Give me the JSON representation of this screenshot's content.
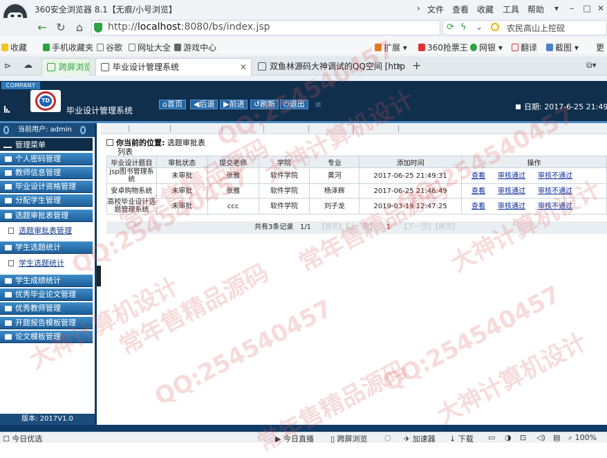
{
  "browser": {
    "window_title": "360安全浏览器 8.1【无痕/小号浏览】",
    "menu": [
      "文件",
      "查看",
      "收藏",
      "工具",
      "帮助"
    ],
    "url_scheme": "http://",
    "url_host": "localhost",
    "url_rest": ":8080/bs/index.jsp",
    "search_text": "农民高山上挖砚",
    "bookmarks": [
      "收藏",
      "手机收藏夹",
      "谷歌",
      "网址大全",
      "游戏中心",
      "扩展",
      "360抢票王",
      "网银",
      "翻译",
      "截图",
      "更"
    ],
    "tabs": [
      {
        "label": "跨屏浏览"
      },
      {
        "label": "毕业设计管理系统"
      },
      {
        "label": "双鱼林源码大神调试的QQ空间 [http"
      }
    ],
    "status": [
      "今日优选",
      "今日直播",
      "跨屏浏览",
      "加速器",
      "下载",
      "100%"
    ]
  },
  "app": {
    "company": "COMPANY",
    "logo_text": "TD",
    "title": "毕业设计管理系统",
    "nav": [
      "首页",
      "后退",
      "前进",
      "刷新",
      "退出"
    ],
    "date_label": "日期: 2017-6-25 21:49:",
    "current_user": "当前用户: admin",
    "menu_head": "管理菜单",
    "menu": [
      {
        "label": "个人密码管理"
      },
      {
        "label": "教师信息管理"
      },
      {
        "label": "毕业设计资格管理"
      },
      {
        "label": "分配学生管理"
      },
      {
        "label": "选题审批表管理"
      },
      {
        "label": "选题审批表管理",
        "sub": true
      },
      {
        "label": "学生选题统计"
      },
      {
        "label": "学生选题统计",
        "sub": true
      },
      {
        "label": "学生成绩统计"
      },
      {
        "label": "优秀毕业论文管理"
      },
      {
        "label": "优秀教师管理"
      },
      {
        "label": "开题报告模板管理"
      },
      {
        "label": "论文模板管理"
      }
    ],
    "version": "版本: 2017V1.0",
    "location_label": "你当前的位置:",
    "location_value": "选题审批表",
    "location_tail": "列表",
    "table": {
      "headers": [
        "毕业设计题目",
        "审批状态",
        "提交老师",
        "学院",
        "专业",
        "添加时间",
        "操作"
      ],
      "rows": [
        {
          "title": "jsp图书管理系统",
          "status": "未审批",
          "teacher": "张雅",
          "college": "软件学院",
          "major": "黄河",
          "time": "2017-06-25 21:49:31"
        },
        {
          "title": "安卓购物系统",
          "status": "未审批",
          "teacher": "张雅",
          "college": "软件学院",
          "major": "杨泽辉",
          "time": "2017-06-25 21:46:49"
        },
        {
          "title": "高校毕业设计选题管理系统",
          "status": "未审批",
          "teacher": "ccc",
          "college": "软件学院",
          "major": "刘子龙",
          "time": "2019-03-19 12:47:25"
        }
      ],
      "actions": [
        "查看",
        "审核通过",
        "审核不通过"
      ]
    },
    "pager": {
      "summary": "共有3条记录",
      "pages": "1/1",
      "first": "【首页】",
      "prev": "【上一页】",
      "current": "1",
      "next": "【下一页】",
      "last": "【尾页】"
    }
  },
  "watermark": [
    "QQ:254540457",
    "大神计算机设计",
    "常年售精品源码"
  ]
}
